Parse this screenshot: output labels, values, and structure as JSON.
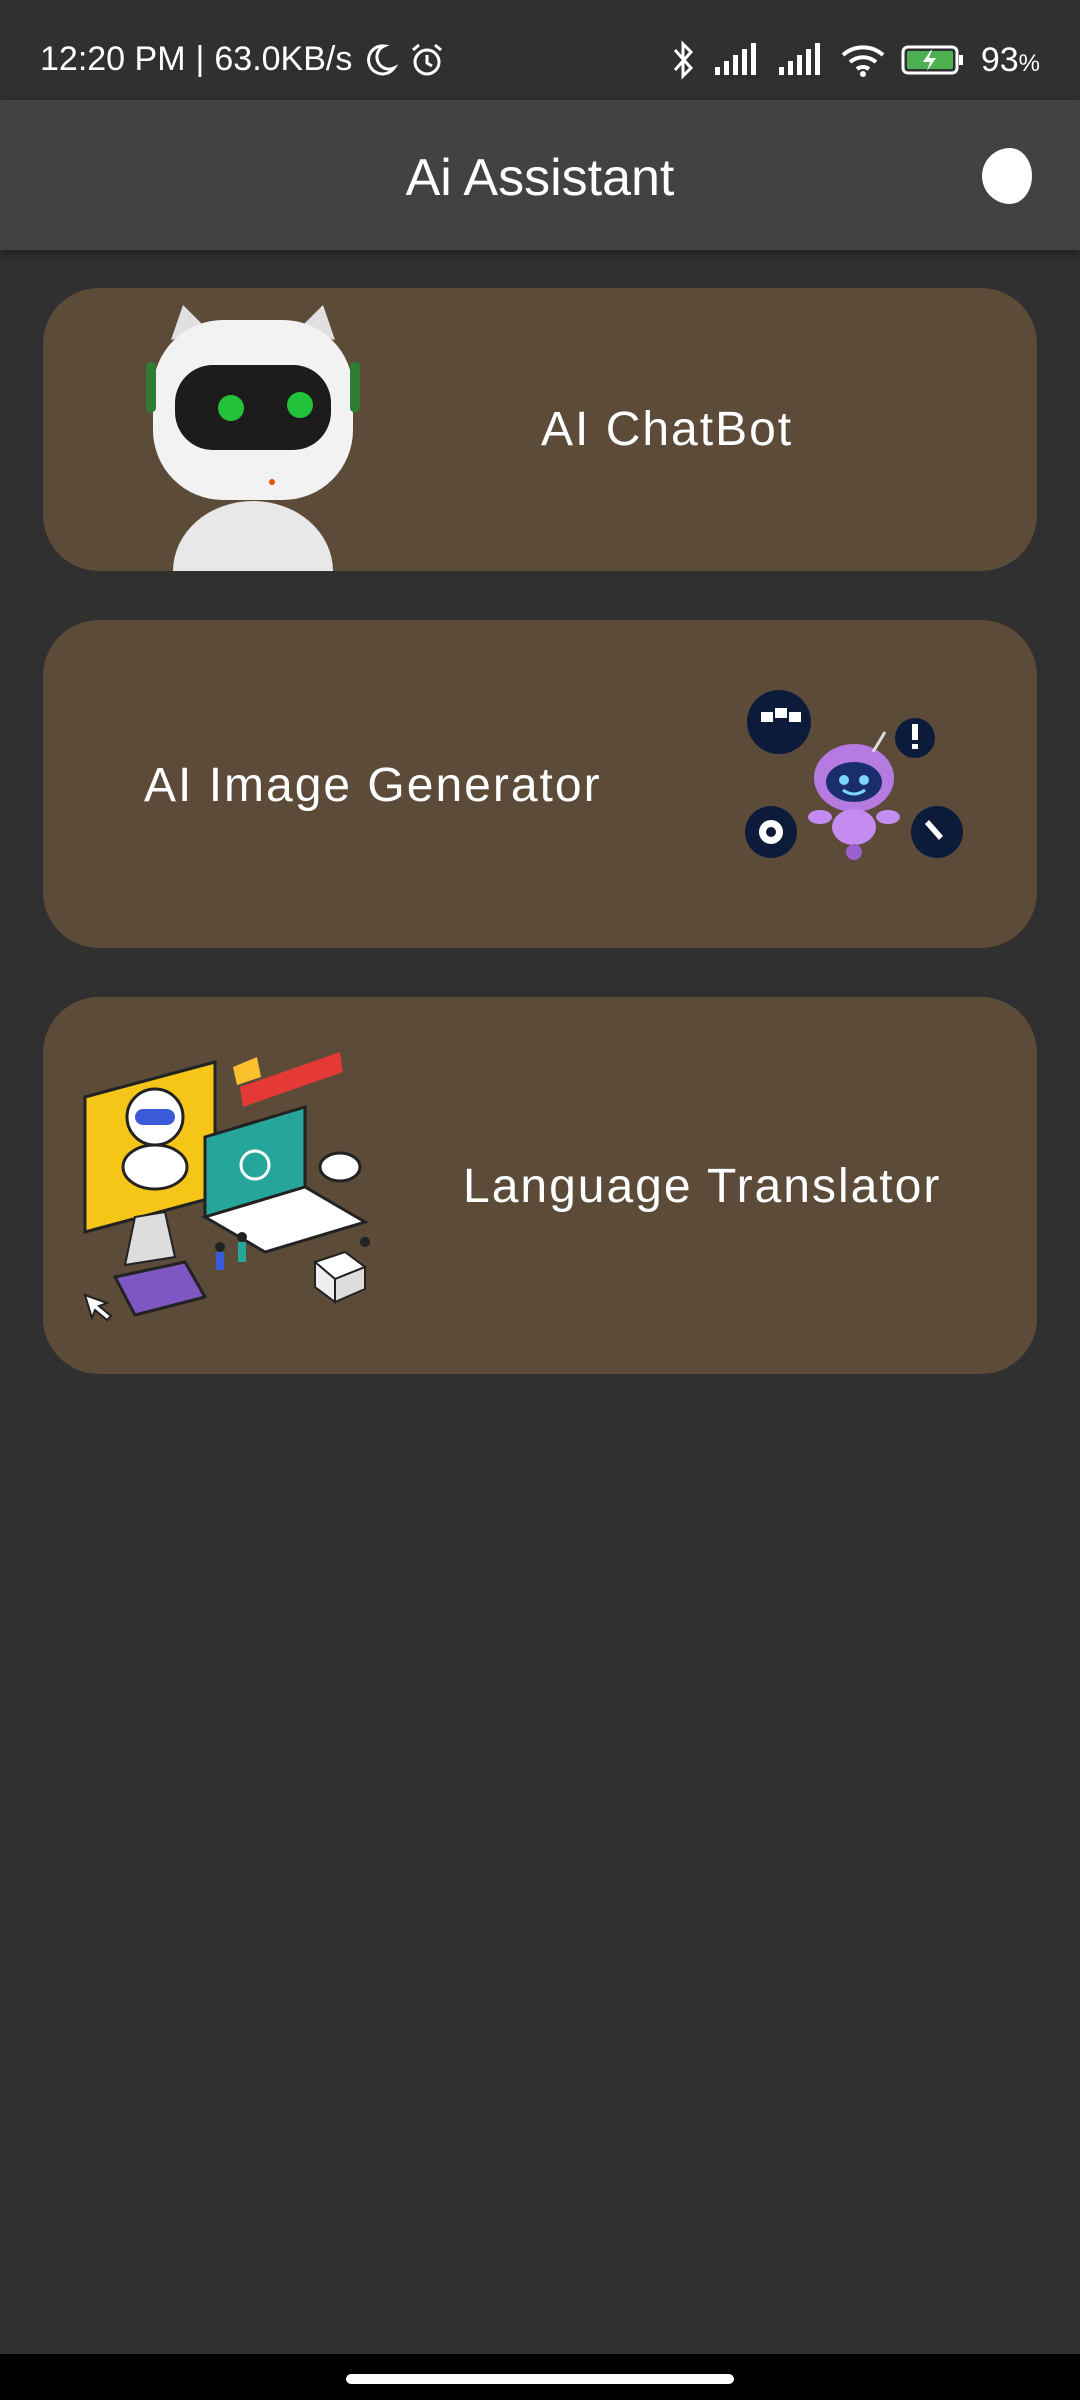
{
  "status_bar": {
    "time": "12:20 PM",
    "separator": "|",
    "network_speed": "63.0KB/s",
    "battery_percent": "93",
    "battery_unit": "%",
    "icons": [
      "moon-icon",
      "alarm-icon",
      "bluetooth-icon",
      "signal-icon",
      "signal-icon",
      "wifi-icon",
      "battery-charging-icon"
    ]
  },
  "appbar": {
    "title": "Ai Assistant",
    "theme_icon": "moon-icon"
  },
  "cards": [
    {
      "title": "AI ChatBot",
      "icon": "robot-head-icon"
    },
    {
      "title": "AI Image Generator",
      "icon": "robot-assistant-icon"
    },
    {
      "title": "Language Translator",
      "icon": "tech-support-illustration"
    }
  ],
  "colors": {
    "background": "#303030",
    "appbar": "#424242",
    "card": "#5b4b38",
    "text": "#ffffff"
  }
}
